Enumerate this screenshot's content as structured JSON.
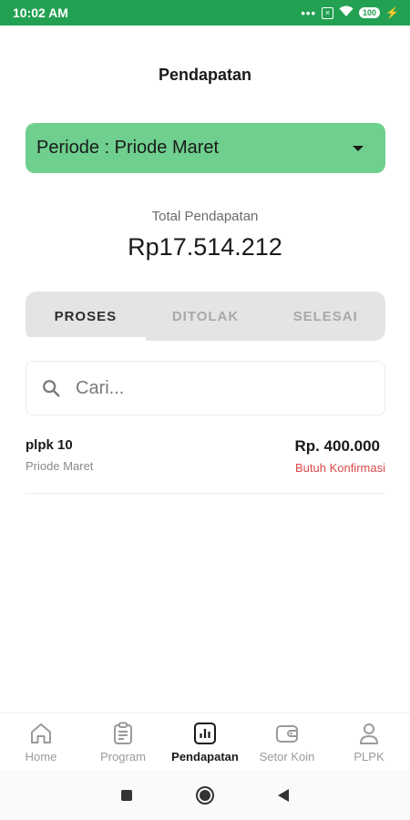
{
  "status_bar": {
    "time": "10:02 AM",
    "dots": "•••",
    "battery": "100"
  },
  "page": {
    "title": "Pendapatan"
  },
  "period": {
    "label": "Periode : Priode Maret"
  },
  "total": {
    "label": "Total Pendapatan",
    "value": "Rp17.514.212"
  },
  "tabs": [
    {
      "label": "PROSES",
      "active": true
    },
    {
      "label": "DITOLAK",
      "active": false
    },
    {
      "label": "SELESAI",
      "active": false
    }
  ],
  "search": {
    "placeholder": "Cari..."
  },
  "items": [
    {
      "name": "plpk 10",
      "period": "Priode Maret",
      "amount": "Rp. 400.000",
      "status": "Butuh Konfirmasi"
    }
  ],
  "nav": [
    {
      "label": "Home",
      "icon": "home-icon"
    },
    {
      "label": "Program",
      "icon": "clipboard-icon"
    },
    {
      "label": "Pendapatan",
      "icon": "chart-icon",
      "active": true
    },
    {
      "label": "Setor Koin",
      "icon": "wallet-icon"
    },
    {
      "label": "PLPK",
      "icon": "user-icon"
    }
  ],
  "colors": {
    "status_bar": "#23a152",
    "period_bg": "#6fcf8e",
    "status_warning": "#d94a4a"
  }
}
